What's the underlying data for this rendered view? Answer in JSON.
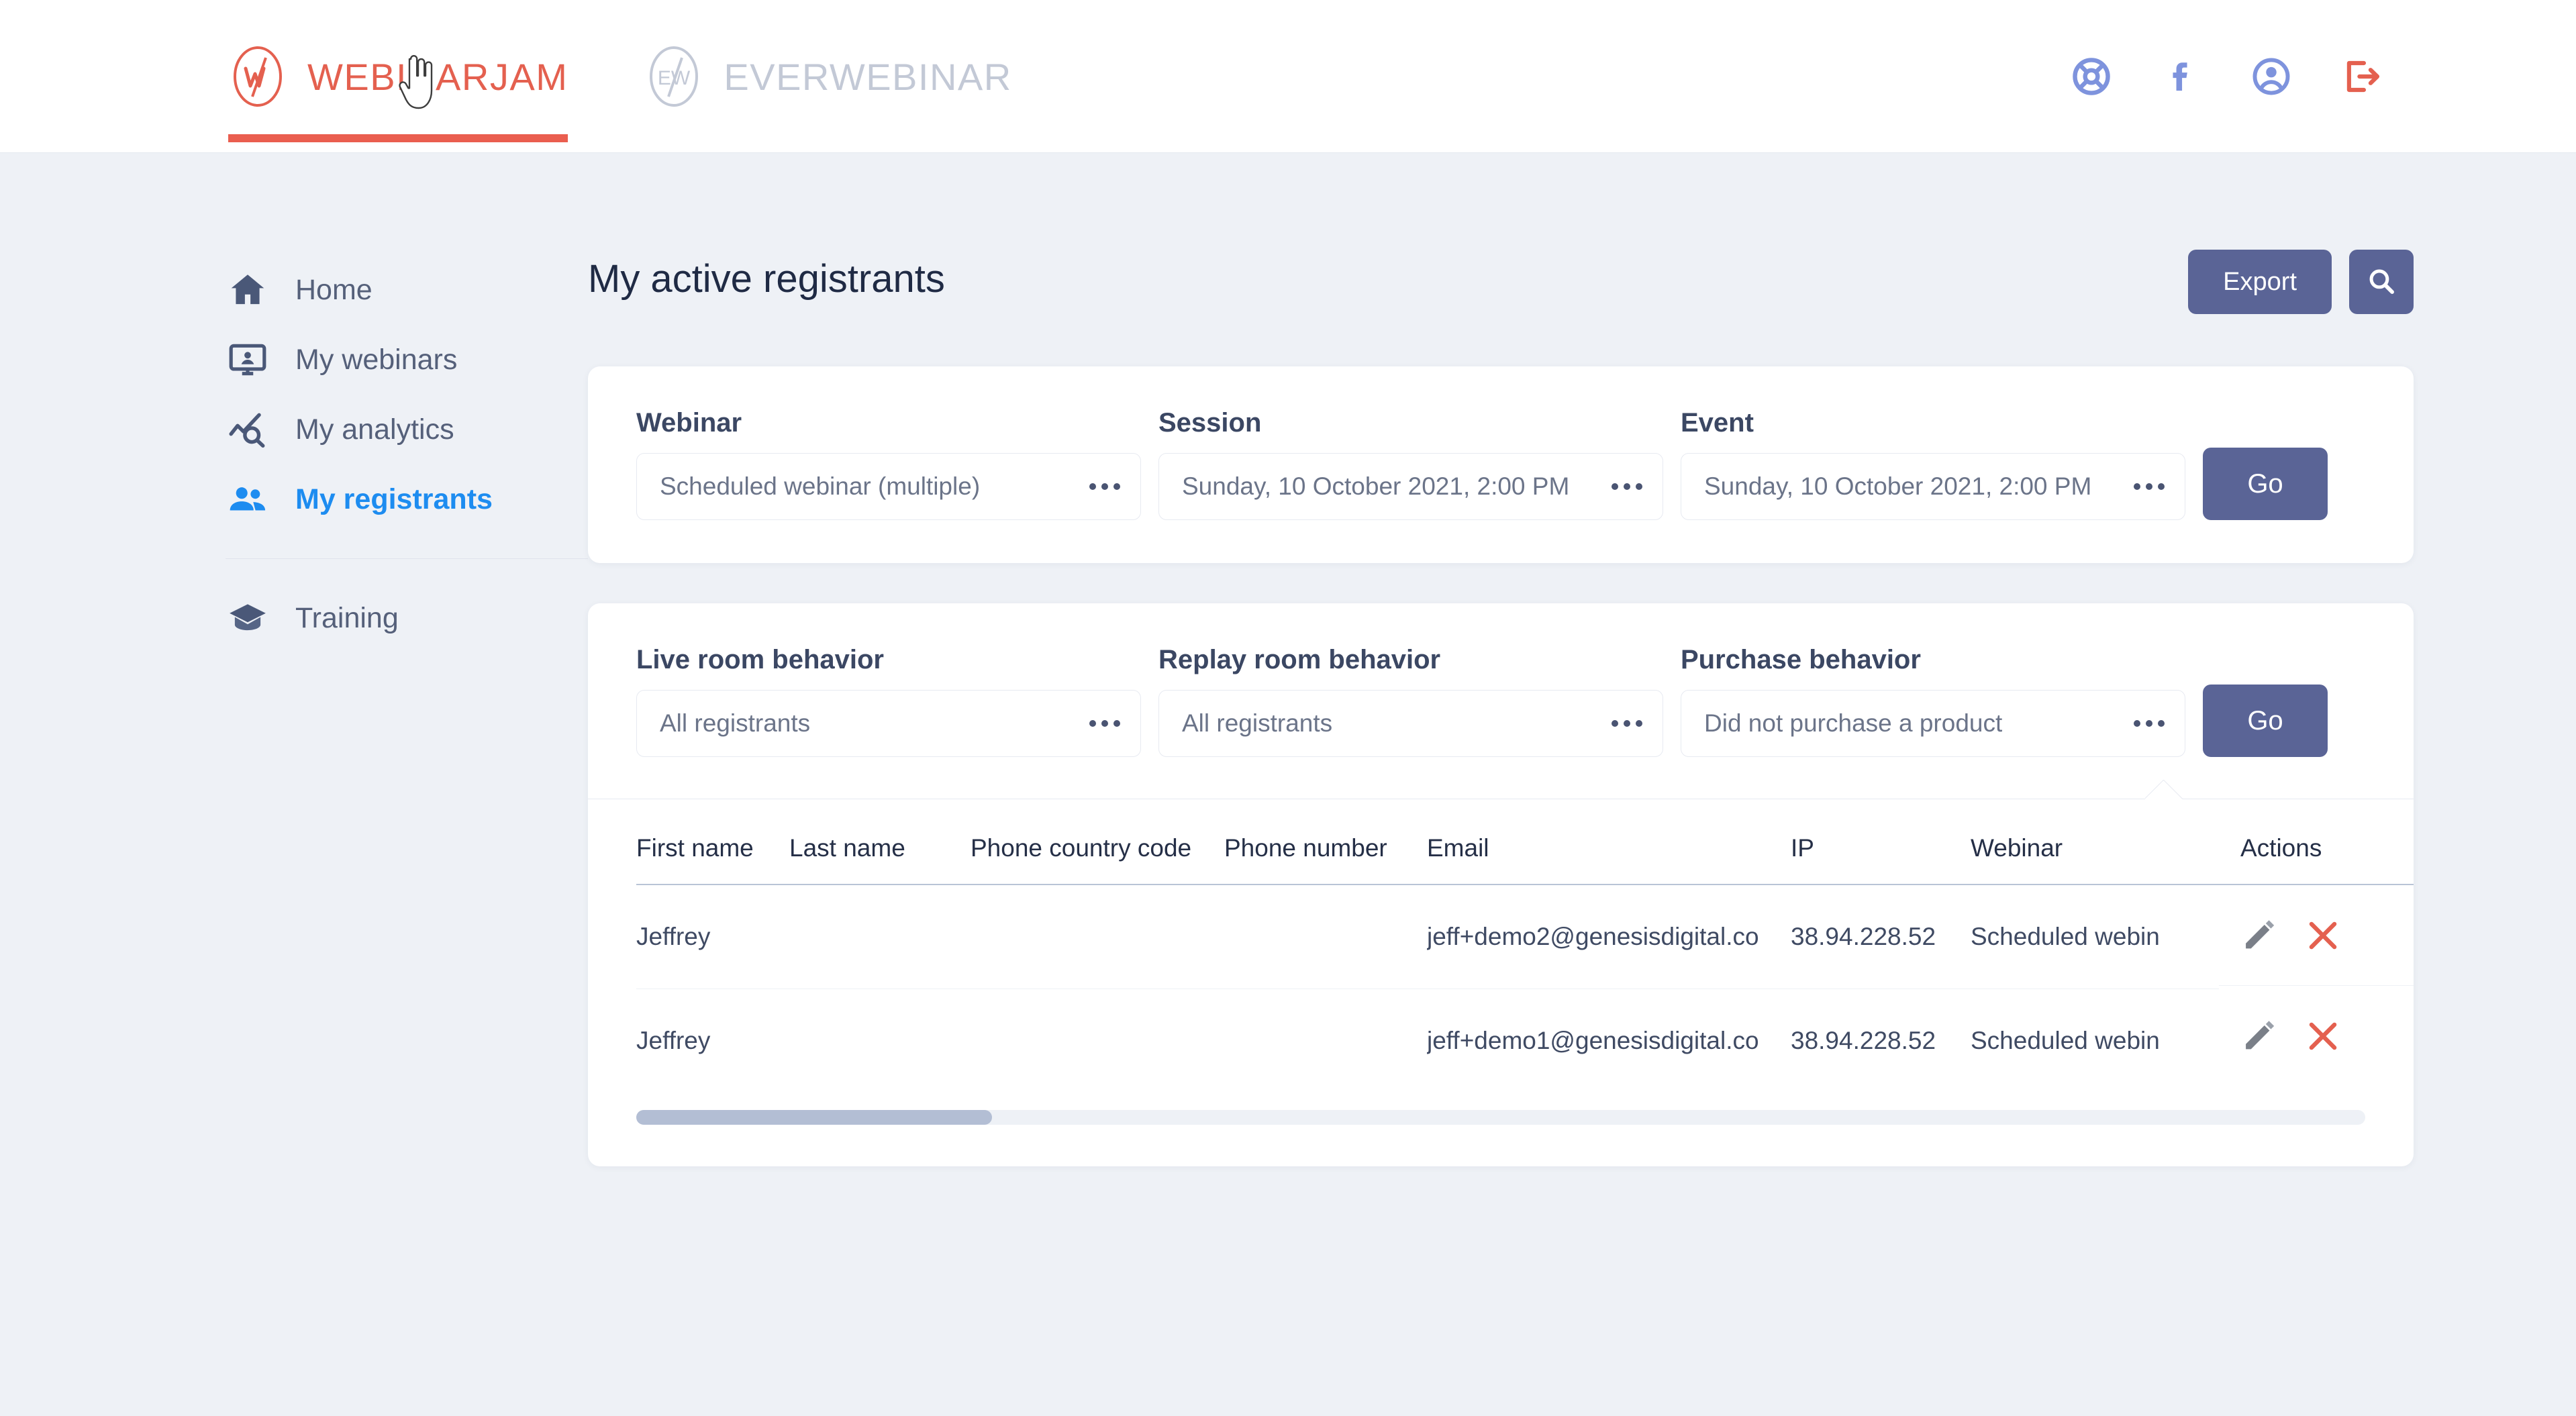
{
  "brand": {
    "webinarjam": {
      "label": "WEBINARJAM",
      "mark": "W/",
      "accent": "#e4604f",
      "underline": "#ea5e4f"
    },
    "everwebinar": {
      "label": "EVERWEBINAR",
      "mark": "EW",
      "accent": "#c3c9d6"
    }
  },
  "header_icons": [
    {
      "name": "support-lifebuoy-icon",
      "color": "#7e93dd"
    },
    {
      "name": "facebook-icon",
      "color": "#7e93dd"
    },
    {
      "name": "account-icon",
      "color": "#7e93dd"
    },
    {
      "name": "logout-icon",
      "color": "#e4604f"
    }
  ],
  "sidebar": {
    "items": [
      {
        "label": "Home",
        "icon": "home-icon",
        "active": false
      },
      {
        "label": "My webinars",
        "icon": "monitor-user-icon",
        "active": false
      },
      {
        "label": "My analytics",
        "icon": "analytics-icon",
        "active": false
      },
      {
        "label": "My registrants",
        "icon": "people-icon",
        "active": true
      },
      {
        "label": "Training",
        "icon": "graduation-cap-icon",
        "active": false
      }
    ],
    "active_color": "#1d8cf0",
    "inactive_color": "#55607a"
  },
  "page": {
    "title": "My active registrants",
    "export_label": "Export",
    "search_icon": "search-icon",
    "button_color": "#5a6496"
  },
  "filters_primary": {
    "go_label": "Go",
    "fields": [
      {
        "label": "Webinar",
        "value": "Scheduled webinar (multiple)",
        "name": "webinar-select"
      },
      {
        "label": "Session",
        "value": "Sunday, 10 October 2021, 2:00 PM",
        "name": "session-select"
      },
      {
        "label": "Event",
        "value": "Sunday, 10 October 2021, 2:00 PM",
        "name": "event-select"
      }
    ]
  },
  "filters_behavior": {
    "go_label": "Go",
    "fields": [
      {
        "label": "Live room behavior",
        "value": "All registrants",
        "name": "live-room-behavior-select"
      },
      {
        "label": "Replay room behavior",
        "value": "All registrants",
        "name": "replay-room-behavior-select"
      },
      {
        "label": "Purchase behavior",
        "value": "Did not purchase a product",
        "name": "purchase-behavior-select"
      }
    ]
  },
  "table": {
    "columns": [
      "First name",
      "Last name",
      "Phone country code",
      "Phone number",
      "Email",
      "IP",
      "Webinar",
      "Actions"
    ],
    "rows": [
      {
        "first_name": "Jeffrey",
        "last_name": "",
        "phone_country_code": "",
        "phone_number": "",
        "email": "jeff+demo2@genesisdigital.co",
        "ip": "38.94.228.52",
        "webinar": "Scheduled webin"
      },
      {
        "first_name": "Jeffrey",
        "last_name": "",
        "phone_country_code": "",
        "phone_number": "",
        "email": "jeff+demo1@genesisdigital.co",
        "ip": "38.94.228.52",
        "webinar": "Scheduled webin"
      }
    ],
    "action_icons": [
      {
        "name": "edit-pencil-icon",
        "color": "#7a7f88"
      },
      {
        "name": "delete-x-icon",
        "color": "#e4604f"
      }
    ],
    "scroll_position_percent": 0
  }
}
